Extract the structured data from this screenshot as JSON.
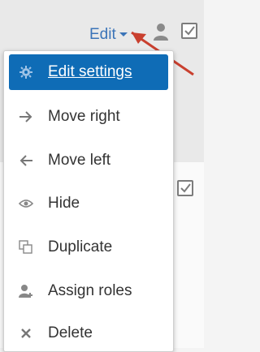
{
  "header": {
    "edit_label": "Edit",
    "user_icon": "user-icon",
    "checkbox_icon": "checkbox-checked-icon"
  },
  "menu": {
    "items": [
      {
        "label": "Edit settings",
        "icon": "gear-icon",
        "active": true
      },
      {
        "label": "Move right",
        "icon": "arrow-right-icon"
      },
      {
        "label": "Move left",
        "icon": "arrow-left-icon"
      },
      {
        "label": "Hide",
        "icon": "eye-icon"
      },
      {
        "label": "Duplicate",
        "icon": "duplicate-icon"
      },
      {
        "label": "Assign roles",
        "icon": "assign-roles-icon"
      },
      {
        "label": "Delete",
        "icon": "delete-x-icon"
      }
    ]
  },
  "colors": {
    "accent": "#0f6cb6",
    "link": "#3b74b8",
    "annotation_arrow": "#c9402f"
  }
}
